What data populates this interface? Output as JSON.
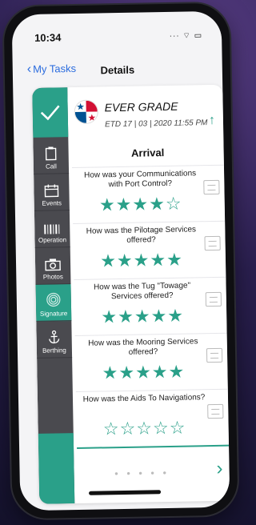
{
  "status": {
    "time": "10:34",
    "indicators": "··· ⌔ ▭"
  },
  "nav": {
    "back_label": "My Tasks",
    "title": "Details"
  },
  "sidebar": {
    "items": [
      {
        "label": "Call",
        "icon": "clipboard-icon"
      },
      {
        "label": "Events",
        "icon": "calendar-icon"
      },
      {
        "label": "Operation",
        "icon": "barcode-icon"
      },
      {
        "label": "Photos",
        "icon": "camera-icon"
      },
      {
        "label": "Signature",
        "icon": "fingerprint-icon",
        "active": true
      },
      {
        "label": "Berthing",
        "icon": "anchor-icon"
      }
    ]
  },
  "vessel": {
    "name": "EVER GRADE",
    "etd": "ETD 17 | 03 | 2020 11:55 PM"
  },
  "section_title": "Arrival",
  "questions": [
    {
      "text": "How was your Communications with Port Control?",
      "rating": 4,
      "stars": "★★★★☆"
    },
    {
      "text": "How was the Pilotage Services offered?",
      "rating": 5,
      "stars": "★★★★★"
    },
    {
      "text": "How was the Tug \"Towage\" Services offered?",
      "rating": 5,
      "stars": "★★★★★"
    },
    {
      "text": "How was the Mooring Services offered?",
      "rating": 5,
      "stars": "★★★★★"
    },
    {
      "text": "How was the Aids To Navigations?",
      "rating": 0,
      "stars": "☆☆☆☆☆"
    }
  ],
  "pager": {
    "dots": "● ● ● ● ●",
    "next": "›"
  },
  "colors": {
    "accent": "#2aa089",
    "sidebar": "#4a4a4f",
    "link": "#2b6cde"
  }
}
